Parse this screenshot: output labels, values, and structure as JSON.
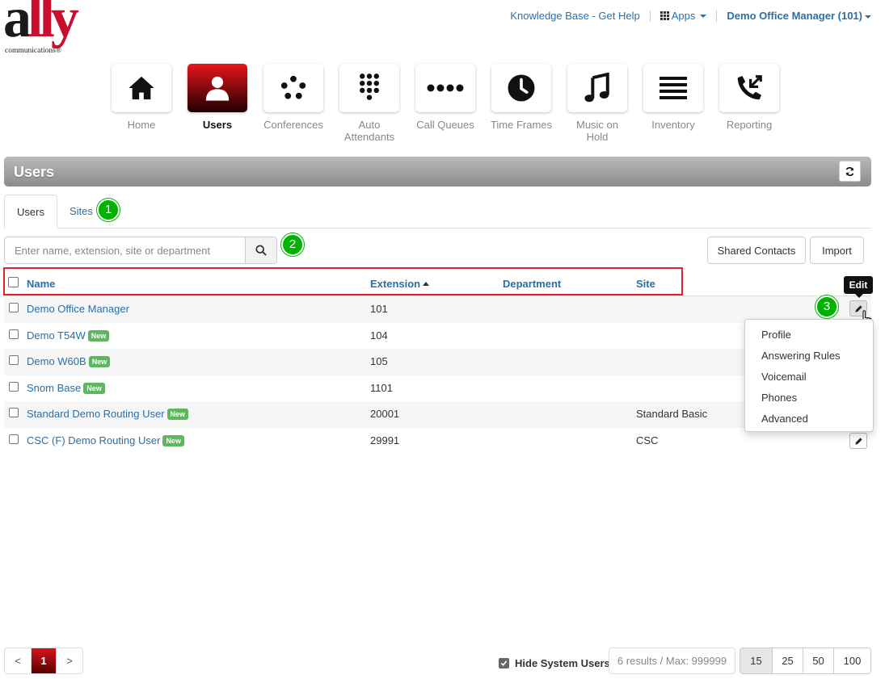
{
  "logo": {
    "brand_main": "a",
    "brand_red": "lly",
    "tagline": "communications®"
  },
  "header": {
    "help_link": "Knowledge Base - Get Help",
    "apps_label": "Apps",
    "user_menu": "Demo Office Manager (101)"
  },
  "apps": [
    {
      "label": "Home",
      "icon": "home-icon"
    },
    {
      "label": "Users",
      "icon": "user-icon",
      "active": true
    },
    {
      "label": "Conferences",
      "icon": "conference-icon"
    },
    {
      "label": "Auto Attendants",
      "icon": "keypad-icon"
    },
    {
      "label": "Call Queues",
      "icon": "queue-dots-icon"
    },
    {
      "label": "Time Frames",
      "icon": "clock-icon"
    },
    {
      "label": "Music on Hold",
      "icon": "music-note-icon"
    },
    {
      "label": "Inventory",
      "icon": "list-icon"
    },
    {
      "label": "Reporting",
      "icon": "phone-reporting-icon"
    }
  ],
  "section": {
    "title": "Users"
  },
  "tabs": [
    {
      "label": "Users"
    },
    {
      "label": "Sites"
    }
  ],
  "annotations": [
    "1",
    "2",
    "3"
  ],
  "search": {
    "placeholder": "Enter name, extension, site or department"
  },
  "actions": {
    "shared_contacts": "Shared Contacts",
    "import": "Import"
  },
  "table": {
    "columns": {
      "name": "Name",
      "extension": "Extension",
      "department": "Department",
      "site": "Site"
    },
    "new_label": "New",
    "rows": [
      {
        "name": "Demo Office Manager",
        "extension": "101",
        "department": "",
        "site": "",
        "new": false
      },
      {
        "name": "Demo T54W",
        "extension": "104",
        "department": "",
        "site": "",
        "new": true
      },
      {
        "name": "Demo W60B",
        "extension": "105",
        "department": "",
        "site": "",
        "new": true
      },
      {
        "name": "Snom Base",
        "extension": "1101",
        "department": "",
        "site": "",
        "new": true
      },
      {
        "name": "Standard Demo Routing User",
        "extension": "20001",
        "department": "",
        "site": "Standard Basic",
        "new": true
      },
      {
        "name": "CSC (F) Demo Routing User",
        "extension": "29991",
        "department": "",
        "site": "CSC",
        "new": true
      }
    ]
  },
  "tooltip": "Edit",
  "edit_menu": [
    "Profile",
    "Answering Rules",
    "Voicemail",
    "Phones",
    "Advanced"
  ],
  "footer": {
    "prev": "<",
    "page": "1",
    "next": ">",
    "hide_system_users": "Hide System Users",
    "hide_system_checked": true,
    "results": "6 results / Max: 999999",
    "page_sizes": [
      "15",
      "25",
      "50",
      "100"
    ],
    "selected_page_size": "15"
  },
  "colors": {
    "link": "#2a6fa8",
    "accent": "#e0242b",
    "badge": "#00b300",
    "new_tag": "#5cb85c"
  }
}
